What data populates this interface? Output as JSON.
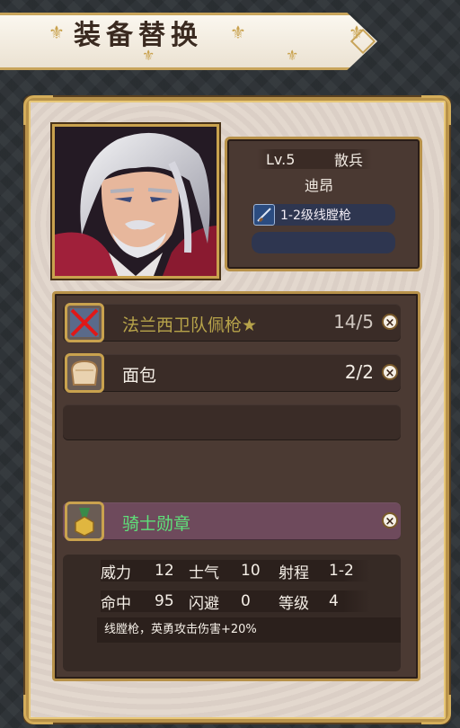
{
  "title": "装备替换",
  "unit": {
    "level": "Lv.5",
    "class": "散兵",
    "name": "迪昂",
    "weapon": "1-2级线膛枪"
  },
  "equipment": [
    {
      "name": "法兰西卫队佩枪★",
      "count": "14/5",
      "icon": "disabled-gun-icon",
      "name_color": "#b7a34a",
      "count_color": "#cfc6bf"
    },
    {
      "name": "面包",
      "count": "2/2",
      "icon": "bread-icon",
      "name_color": "#f4eee6",
      "count_color": "#f4eee6"
    }
  ],
  "accessory": {
    "name": "骑士勋章",
    "icon": "medal-icon",
    "name_color": "#5fe07a"
  },
  "remove_symbol": "×",
  "stats": {
    "row1": [
      {
        "label": "威力",
        "value": "12"
      },
      {
        "label": "士气",
        "value": "10"
      },
      {
        "label": "射程",
        "value": "1-2"
      }
    ],
    "row2": [
      {
        "label": "命中",
        "value": "95"
      },
      {
        "label": "闪避",
        "value": "0"
      },
      {
        "label": "等级",
        "value": "4"
      }
    ],
    "description": "线膛枪，英勇攻击伤害+20%"
  },
  "colors": {
    "gold_frame": "#b8924a",
    "panel_bg": "#e2d6cc",
    "slot_bg": "#3a2c27",
    "medal_slot_bg": "#6e4a5c"
  }
}
